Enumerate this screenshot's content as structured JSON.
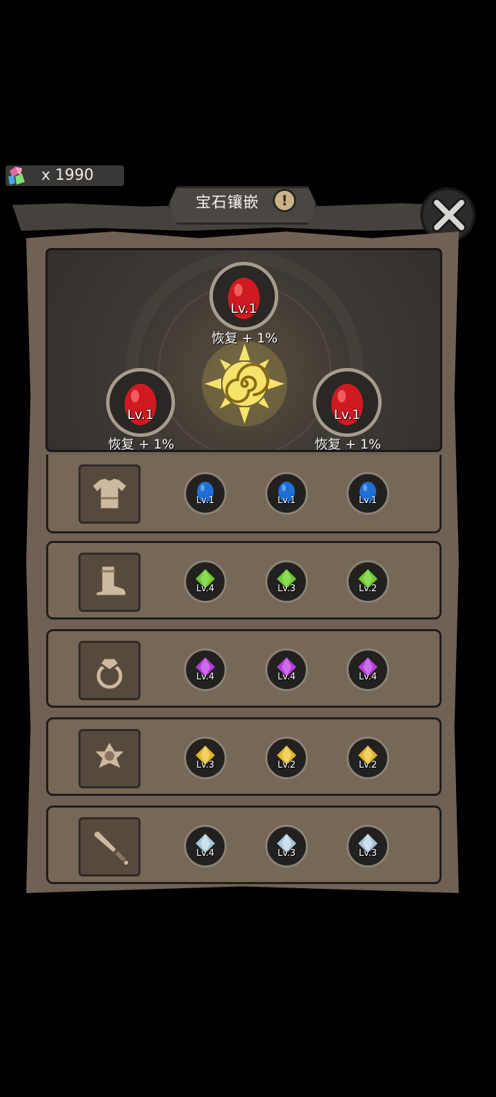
{
  "currency": {
    "icon": "crystal-icon",
    "amount": "x 1990"
  },
  "header": {
    "title": "宝石镶嵌",
    "info_icon": "exclamation-icon",
    "close_icon": "close-x-icon"
  },
  "core": {
    "slots": [
      {
        "level": "Lv.1",
        "bonus": "恢复 + 1%",
        "gem_color": "#d01a22"
      },
      {
        "level": "Lv.1",
        "bonus": "恢复 + 1%",
        "gem_color": "#d01a22"
      },
      {
        "level": "Lv.1",
        "bonus": "恢复 + 1%",
        "gem_color": "#d01a22"
      }
    ]
  },
  "equipment": [
    {
      "item": "armor-icon",
      "gem_shape": "egg",
      "gem_color": "#1e6fd4",
      "levels": [
        "Lv.1",
        "Lv.1",
        "Lv.1"
      ]
    },
    {
      "item": "boot-icon",
      "gem_shape": "diamond",
      "gem_color": "#6ec933",
      "levels": [
        "Lv.4",
        "Lv.3",
        "Lv.2"
      ]
    },
    {
      "item": "ring-icon",
      "gem_shape": "diamond",
      "gem_color": "#b23ed8",
      "levels": [
        "Lv.4",
        "Lv.4",
        "Lv.4"
      ]
    },
    {
      "item": "amulet-icon",
      "gem_shape": "diamond",
      "gem_color": "#e0b52a",
      "levels": [
        "Lv.3",
        "Lv.2",
        "Lv.2"
      ]
    },
    {
      "item": "sword-icon",
      "gem_shape": "diamond",
      "gem_color": "#a8c6d8",
      "levels": [
        "Lv.4",
        "Lv.3",
        "Lv.3"
      ]
    }
  ]
}
